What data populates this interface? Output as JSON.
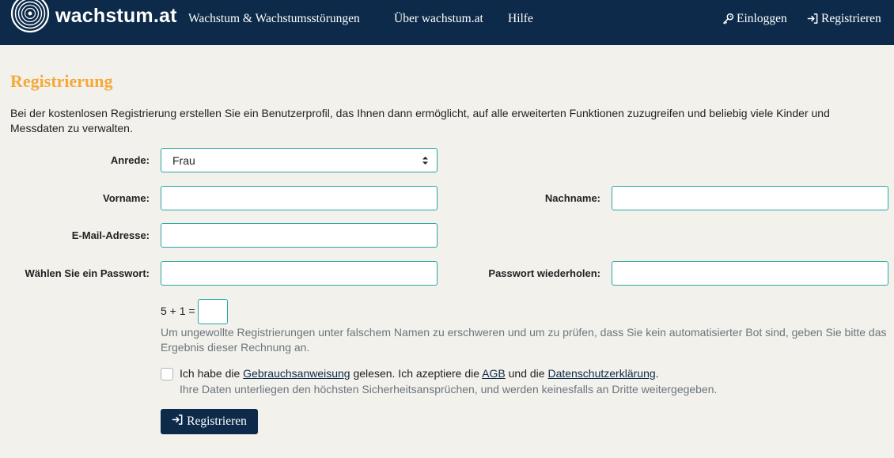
{
  "nav": {
    "brand": "wachstum.at",
    "links": [
      "Wachstum & Wachstumsstörungen",
      "Über wachstum.at",
      "Hilfe"
    ],
    "login": "Einloggen",
    "register": "Registrieren",
    "login_icon": "key-icon",
    "register_icon": "sign-in-icon"
  },
  "page": {
    "title": "Registrierung",
    "intro": "Bei der kostenlosen Registrierung erstellen Sie ein Benutzerprofil, das Ihnen dann ermöglicht, auf alle erweiterten Funktionen zuzugreifen und beliebig viele Kinder und Messdaten zu verwalten."
  },
  "form": {
    "salutation_label": "Anrede:",
    "salutation_value": "Frau",
    "firstname_label": "Vorname:",
    "firstname_value": "",
    "lastname_label": "Nachname:",
    "lastname_value": "",
    "email_label": "E-Mail-Adresse:",
    "email_value": "",
    "password_label": "Wählen Sie ein Passwort:",
    "password_value": "",
    "password_repeat_label": "Passwort wiederholen:",
    "password_repeat_value": "",
    "captcha_question": "5 + 1 =",
    "captcha_value": "",
    "captcha_help": "Um ungewollte Registrierungen unter falschem Namen zu erschweren und um zu prüfen, dass Sie kein automatisierter Bot sind, geben Sie bitte das Ergebnis dieser Rechnung an.",
    "terms_checked": false,
    "terms_part1": "Ich habe die ",
    "terms_link_manual": "Gebrauchsanweisung",
    "terms_part2": " gelesen. Ich azeptiere die ",
    "terms_link_agb": "AGB",
    "terms_part3": " und die ",
    "terms_link_privacy": "Datenschutzerklärung",
    "terms_part4": ".",
    "terms_help": "Ihre Daten unterliegen den höchsten Sicherheitsansprüchen, und werden keinesfalls an Dritte weitergegeben.",
    "submit_label": "Registrieren"
  },
  "colors": {
    "navbar": "#0d2a4a",
    "title": "#f5a93a",
    "input_border": "#2aa6a0",
    "background": "#f2f1ec"
  }
}
